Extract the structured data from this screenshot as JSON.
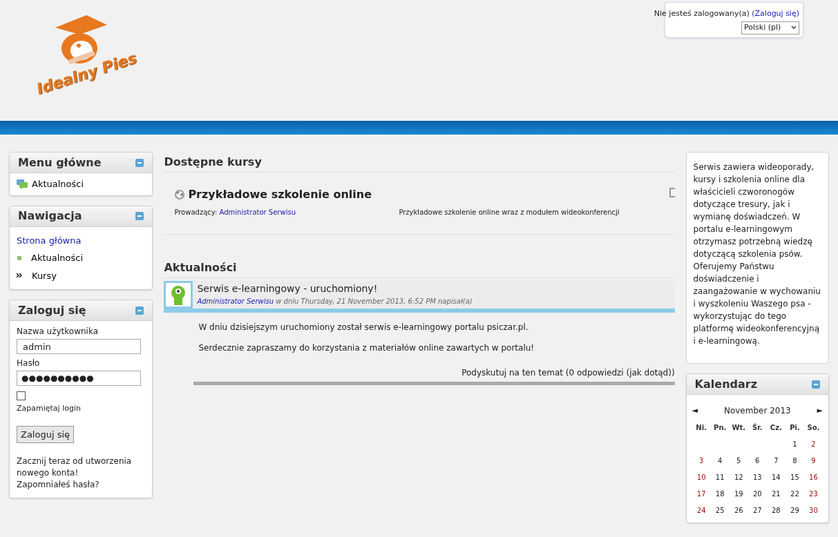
{
  "logo": {
    "text": "Idealny Pies"
  },
  "login_info": {
    "text": "Nie jesteś zalogowany(a)",
    "link": "(Zaloguj się)",
    "language": "Polski (pl)"
  },
  "left_blocks": [
    {
      "kind": "menu",
      "title": "Menu główne",
      "items": [
        "Aktualności"
      ]
    },
    {
      "kind": "nav",
      "title": "Nawigacja",
      "home": "Strona główna",
      "items": [
        {
          "kind": "news",
          "label": "Aktualności"
        },
        {
          "kind": "link",
          "label": "Kursy"
        }
      ]
    },
    {
      "kind": "login",
      "title": "Zaloguj się",
      "username_label": "Nazwa użytkownika",
      "username": "admin",
      "password_label": "Hasło",
      "password": "●●●●●●●●●●",
      "remember": {
        "label": "Zapamiętaj login",
        "checked": false
      },
      "button": "Zaloguj się",
      "signup": "Zacznij teraz od utworzenia nowego konta!",
      "forgot": "Zapomniałeś hasła?"
    }
  ],
  "courses": {
    "heading": "Dostępne kursy",
    "items": [
      {
        "title": "Przykładowe szkolenie online",
        "teacher_label": "Prowadzący:",
        "teacher": "Administrator Serwisu",
        "summary": "Przykładowe szkolenie online wraz z modułem wideokonferencji"
      }
    ]
  },
  "news": {
    "heading": "Aktualności",
    "posts": [
      {
        "subject": "Serwis e-learningowy - uruchomiony!",
        "author": "Administrator Serwisu",
        "meta": "w dniu Thursday, 21 November 2013, 6:52 PM napisał(a)",
        "paragraphs": [
          "W dniu dzisiejszym uruchomiony został serwis e-learningowy portalu psiczar.pl.",
          "Serdecznie zapraszamy do korzystania z materiałów online zawartych w portalu!"
        ],
        "discuss": "Podyskutuj na ten temat (0 odpowiedzi (jak dotąd))"
      }
    ]
  },
  "about": {
    "text": "Serwis zawiera wideoporady, kursy i szkolenia online dla właścicieli czworonogów dotyczące tresury, jak i wymianę doświadczeń. W portalu e-learningowym otrzymasz potrzebną wiedzę dotyczącą szkolenia psów. Oferujemy Państwu doświadczenie i zaangażowanie w wychowaniu i wyszkoleniu Waszego psa - wykorzystując do tego platformę wideokonferencyjną i e-learningową."
  },
  "calendar": {
    "title": "Kalendarz",
    "prev": "◄",
    "month": "November 2013",
    "next": "►",
    "weekdays": [
      "Ni.",
      "Pn.",
      "Wt.",
      "Śr.",
      "Cz.",
      "Pi.",
      "So."
    ],
    "weeks": [
      [
        {
          "day": "1",
          "weekend": false
        },
        {
          "day": "2",
          "weekend": true
        }
      ],
      [
        {
          "day": "3",
          "weekend": true
        },
        {
          "day": "4",
          "weekend": false
        },
        {
          "day": "5",
          "weekend": false
        },
        {
          "day": "6",
          "weekend": false
        },
        {
          "day": "7",
          "weekend": false
        },
        {
          "day": "8",
          "weekend": false
        },
        {
          "day": "9",
          "weekend": true
        }
      ],
      [
        {
          "day": "10",
          "weekend": true
        },
        {
          "day": "11",
          "weekend": false
        },
        {
          "day": "12",
          "weekend": false
        },
        {
          "day": "13",
          "weekend": false
        },
        {
          "day": "14",
          "weekend": false
        },
        {
          "day": "15",
          "weekend": false
        },
        {
          "day": "16",
          "weekend": true
        }
      ],
      [
        {
          "day": "17",
          "weekend": true
        },
        {
          "day": "18",
          "weekend": false
        },
        {
          "day": "19",
          "weekend": false
        },
        {
          "day": "20",
          "weekend": false
        },
        {
          "day": "21",
          "weekend": false
        },
        {
          "day": "22",
          "weekend": false
        },
        {
          "day": "23",
          "weekend": true
        }
      ],
      [
        {
          "day": "24",
          "weekend": true
        },
        {
          "day": "25",
          "weekend": false
        },
        {
          "day": "26",
          "weekend": false
        },
        {
          "day": "27",
          "weekend": false
        },
        {
          "day": "28",
          "weekend": false
        },
        {
          "day": "29",
          "weekend": false
        },
        {
          "day": "30",
          "weekend": true
        }
      ]
    ]
  }
}
